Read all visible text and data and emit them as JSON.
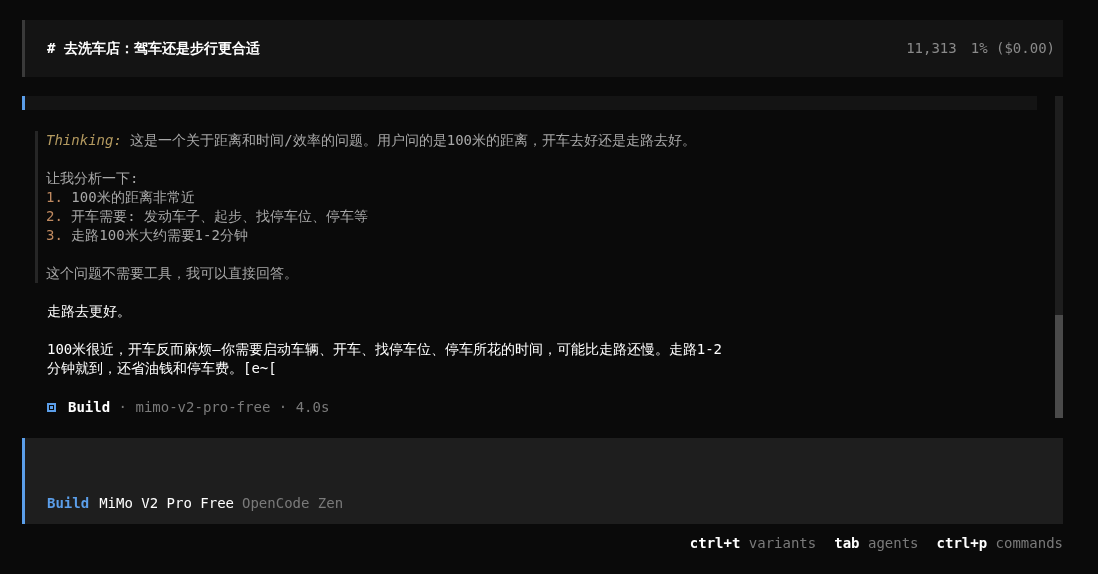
{
  "header": {
    "title": "# 去洗车店：驾车还是步行更合适",
    "tokens": "11,313",
    "usage": "1% ($0.00)"
  },
  "thinking": {
    "label": "Thinking:",
    "intro": "这是一个关于距离和时间/效率的问题。用户问的是100米的距离，开车去好还是走路去好。",
    "lead": "让我分析一下:",
    "items": [
      {
        "number": "1.",
        "text": "100米的距离非常近"
      },
      {
        "number": "2.",
        "text": "开车需要: 发动车子、起步、找停车位、停车等"
      },
      {
        "number": "3.",
        "text": "走路100米大约需要1-2分钟"
      }
    ],
    "conclusion": "这个问题不需要工具，我可以直接回答。"
  },
  "answer": [
    "走路去更好。",
    "100米很近，开车反而麻烦—你需要启动车辆、开车、找停车位、停车所花的时间，可能比走路还慢。走路1-2分钟就到，还省油钱和停车费。[e~["
  ],
  "meta": {
    "agent": "Build",
    "separator": "·",
    "model": "mimo-v2-pro-free",
    "duration": "4.0s"
  },
  "input": {
    "agent": "Build",
    "model": "MiMo V2 Pro Free",
    "provider": "OpenCode Zen"
  },
  "hints": [
    {
      "key": "ctrl+t",
      "label": "variants"
    },
    {
      "key": "tab",
      "label": "agents"
    },
    {
      "key": "ctrl+p",
      "label": "commands"
    }
  ],
  "scrollbar": {
    "level": 0.32
  }
}
